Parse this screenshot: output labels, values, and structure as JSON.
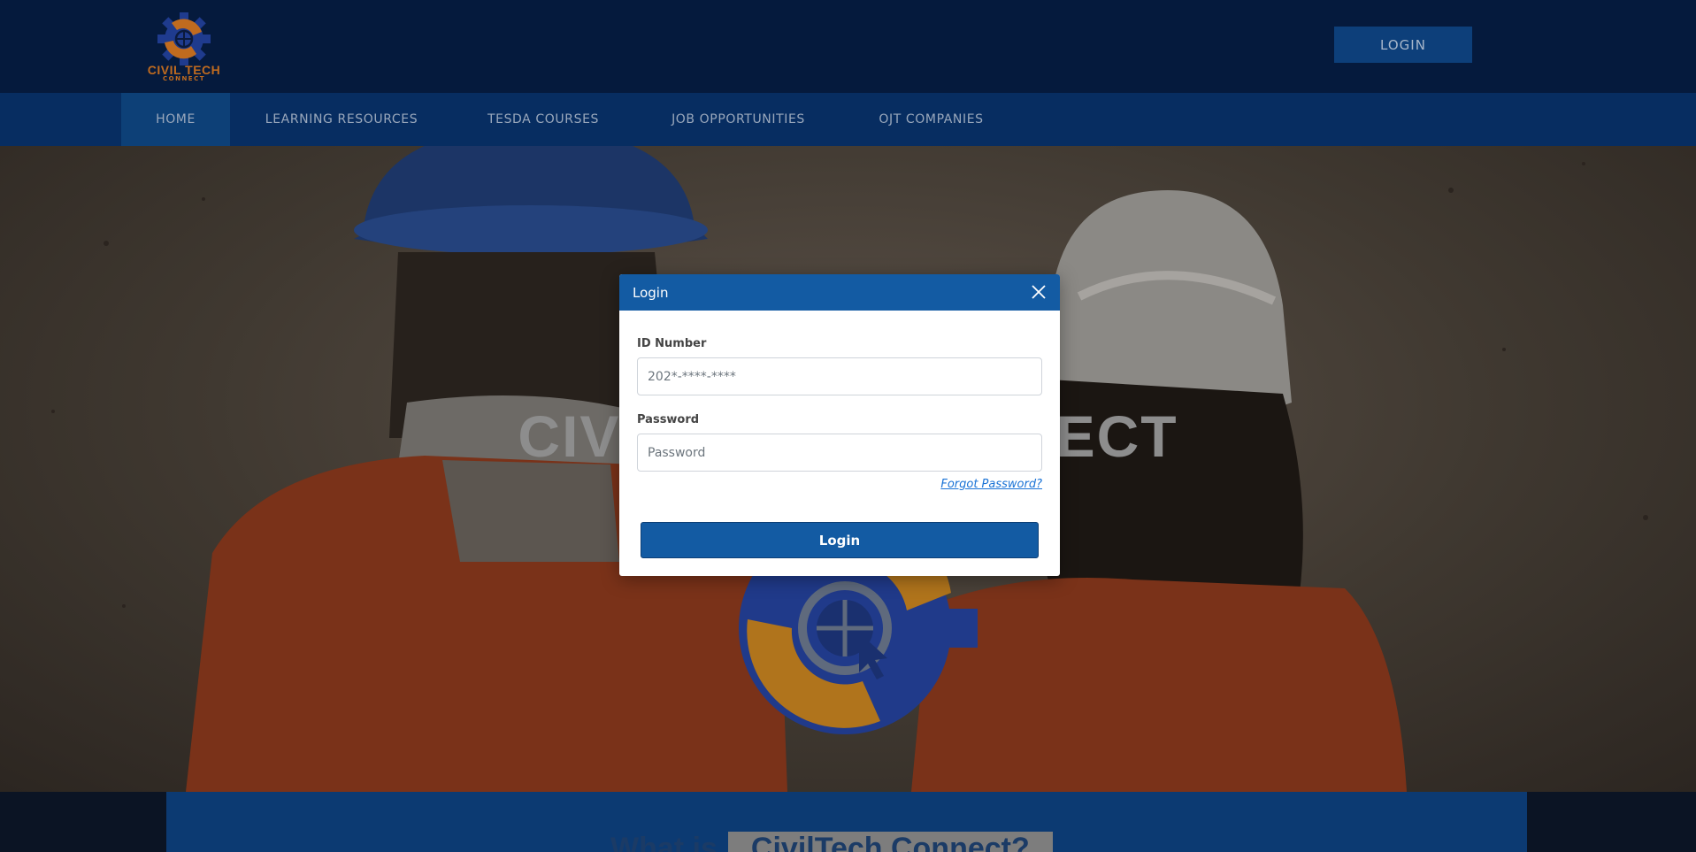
{
  "header": {
    "logo_text": "CIVIL TECH",
    "logo_subtext": "CONNECT",
    "login_button": "LOGIN"
  },
  "nav": {
    "items": [
      {
        "label": "HOME",
        "active": true
      },
      {
        "label": "LEARNING RESOURCES",
        "active": false
      },
      {
        "label": "TESDA COURSES",
        "active": false
      },
      {
        "label": "JOB OPPORTUNITIES",
        "active": false
      },
      {
        "label": "OJT COMPANIES",
        "active": false
      }
    ]
  },
  "hero": {
    "title": "CIVIL TECH CONNECT"
  },
  "about": {
    "prefix": "What is",
    "highlight": "CivilTech Connect?"
  },
  "modal": {
    "title": "Login",
    "id_label": "ID Number",
    "id_placeholder": "202*-****-****",
    "password_label": "Password",
    "password_placeholder": "Password",
    "forgot_link": "Forgot Password?",
    "submit_label": "Login"
  },
  "colors": {
    "header_bg": "#051a3d",
    "nav_bg": "#072d61",
    "nav_active_bg": "#0d4077",
    "modal_header": "#135ba3",
    "primary_button": "#135ba3",
    "link": "#1a73d6",
    "logo_orange": "#c06b1f"
  }
}
